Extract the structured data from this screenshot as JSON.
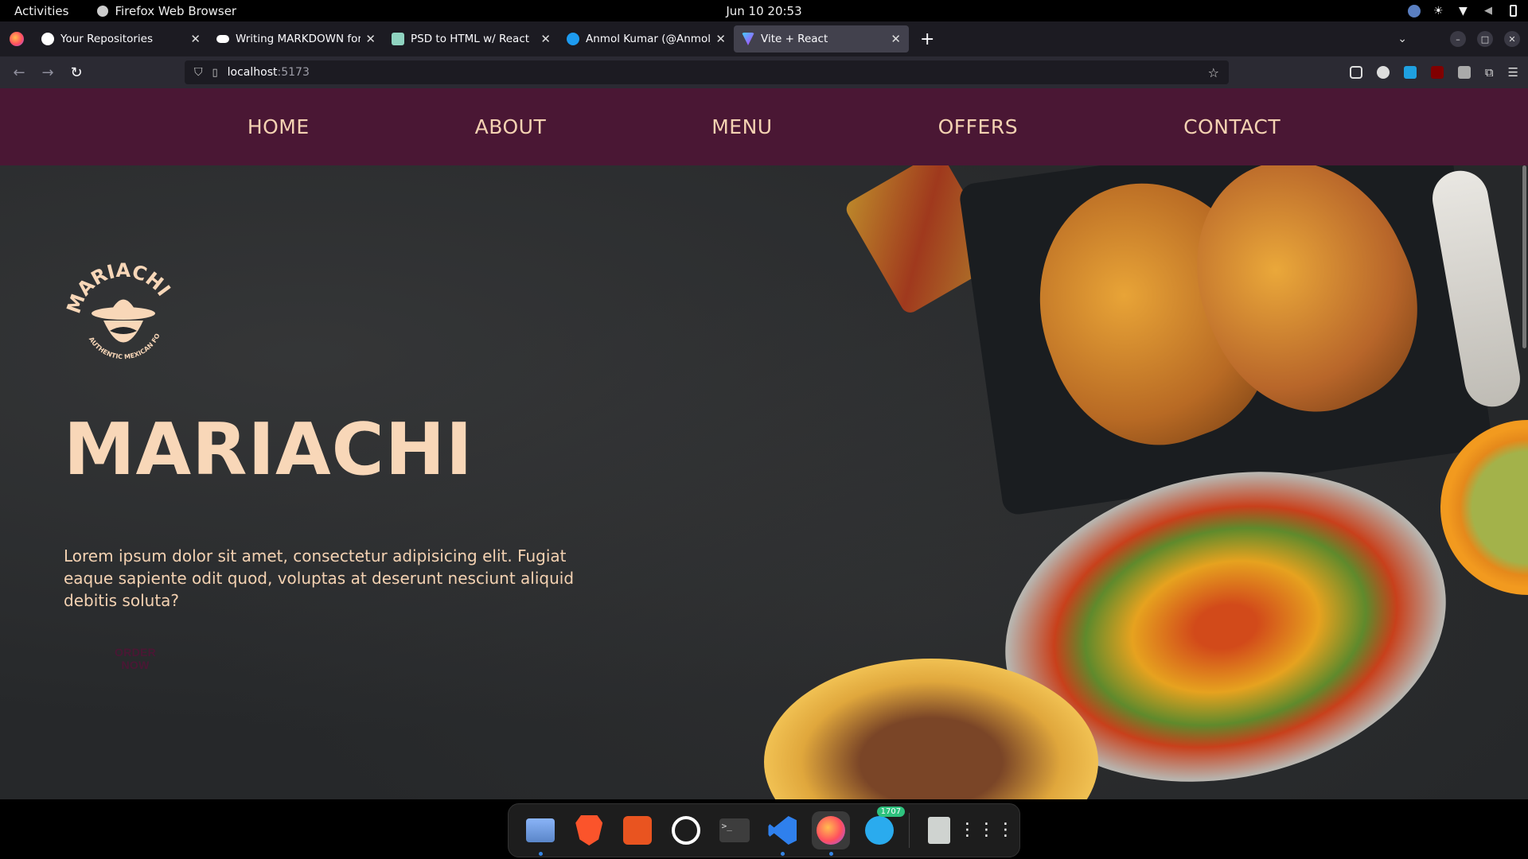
{
  "system": {
    "activities": "Activities",
    "app_name": "Firefox Web Browser",
    "clock": "Jun 10  20:53"
  },
  "tabs": [
    {
      "title": "Your Repositories",
      "favicon": "github-icon",
      "color": "#ffffff"
    },
    {
      "title": "Writing MARKDOWN for yo",
      "favicon": "medium-icon",
      "color": "#ffffff"
    },
    {
      "title": "PSD to HTML w/ React",
      "favicon": "replit-icon",
      "color": "#8fd3c0"
    },
    {
      "title": "Anmol Kumar (@Anmol_kr",
      "favicon": "twitter-icon",
      "color": "#1d9bf0"
    },
    {
      "title": "Vite + React",
      "favicon": "vite-icon",
      "color": "#bd34fe",
      "active": true
    }
  ],
  "url": {
    "host": "localhost",
    "port": ":5173"
  },
  "site": {
    "nav": [
      "HOME",
      "ABOUT",
      "MENU",
      "OFFERS",
      "CONTACT"
    ],
    "logo_text_top": "MARIACHI",
    "logo_text_bottom": "AUTHENTIC MEXICAN FOOD",
    "hero_title": "MARIACHI",
    "hero_text": "Lorem ipsum dolor sit amet, consectetur adipisicing elit. Fugiat eaque sapiente odit quod, voluptas at deserunt nesciunt aliquid debitis soluta?",
    "order_button": "ORDER NOW",
    "colors": {
      "nav_bg": "#4a1734",
      "accent": "#f4d2b2",
      "hero_bg": "#26282a"
    }
  },
  "dock": {
    "items": [
      "files-icon",
      "brave-icon",
      "app-store-icon",
      "whatsapp-icon",
      "terminal-icon",
      "vscode-icon",
      "firefox-icon",
      "telegram-icon",
      "trash-icon",
      "app-grid-icon"
    ],
    "telegram_badge": "1707"
  }
}
